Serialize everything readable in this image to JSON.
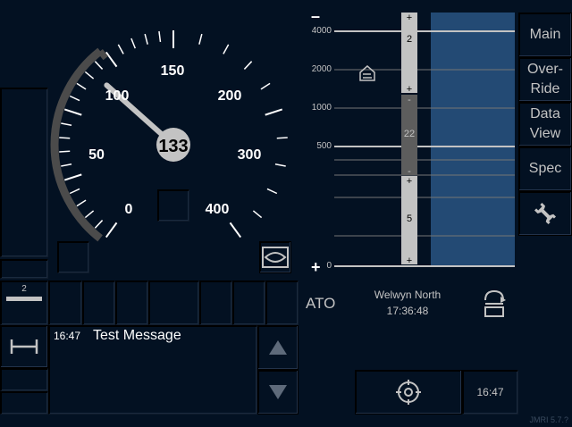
{
  "speedometer": {
    "labels": [
      "0",
      "50",
      "100",
      "150",
      "200",
      "300",
      "400"
    ],
    "current_speed": "133",
    "permitted_speed": "150"
  },
  "left_panel": {
    "gradient_value": "2"
  },
  "planning": {
    "distance_scale": [
      "4000",
      "2000",
      "1000",
      "500",
      "0"
    ],
    "top_sign": "–",
    "bottom_sign": "+",
    "gradient_segments": [
      {
        "top_sign": "+",
        "value": "2",
        "bottom_sign": "+"
      },
      {
        "top_sign": "-",
        "value": "22",
        "bottom_sign": "-"
      },
      {
        "top_sign": "+",
        "value": "5",
        "bottom_sign": "+"
      }
    ]
  },
  "menu": {
    "main": "Main",
    "override_line1": "Over-",
    "override_line2": "Ride",
    "data_line1": "Data",
    "data_line2": "View",
    "spec": "Spec"
  },
  "ato": {
    "label": "ATO",
    "station": "Welwyn North",
    "time": "17:36:48"
  },
  "messages": {
    "time": "16:47",
    "text": "Test Message"
  },
  "bottom": {
    "clock": "16:47",
    "version": "JMRI 5.7.?"
  },
  "icons": {
    "track_condition": "house-arrow-icon",
    "mode": "eye-icon",
    "level": "shunting-icon",
    "scroll_up": "up-arrow-icon",
    "scroll_down": "down-arrow-icon",
    "settings": "wrench-icon",
    "ato_symbol": "train-turn-icon",
    "bottom_symbol": "crosshair-icon"
  },
  "colors": {
    "background": "#031122",
    "text": "#c3c3c3",
    "planning_area": "#234a74",
    "dial_arc": "#4b4b4b"
  }
}
